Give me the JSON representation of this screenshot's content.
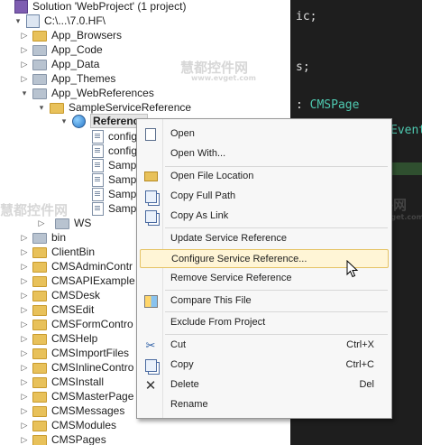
{
  "tree": {
    "items": [
      {
        "label": "Solution 'WebProject' (1 project)",
        "icon": "solution-icon",
        "indent": 0,
        "arrow": ""
      },
      {
        "label": "C:\\...\\7.0.HF\\",
        "icon": "project-icon",
        "indent": 1,
        "arrow": "▾"
      },
      {
        "label": "App_Browsers",
        "icon": "folder-icon",
        "indent": 2,
        "arrow": "▷"
      },
      {
        "label": "App_Code",
        "icon": "special-folder-icon",
        "indent": 2,
        "arrow": "▷"
      },
      {
        "label": "App_Data",
        "icon": "special-folder-icon",
        "indent": 2,
        "arrow": "▷"
      },
      {
        "label": "App_Themes",
        "icon": "special-folder-icon",
        "indent": 2,
        "arrow": "▷"
      },
      {
        "label": "App_WebReferences",
        "icon": "special-folder-icon",
        "indent": 2,
        "arrow": "▾"
      },
      {
        "label": "SampleServiceReference",
        "icon": "folder-icon",
        "indent": 3,
        "arrow": "▾"
      },
      {
        "label": "Reference",
        "icon": "globe-icon",
        "indent": 4,
        "arrow": "▾",
        "selected": true
      },
      {
        "label": "config",
        "icon": "file-icon",
        "indent": 5,
        "arrow": ""
      },
      {
        "label": "config",
        "icon": "file-icon",
        "indent": 5,
        "arrow": ""
      },
      {
        "label": "Samp",
        "icon": "file-icon",
        "indent": 5,
        "arrow": ""
      },
      {
        "label": "Samp",
        "icon": "file-icon",
        "indent": 5,
        "arrow": ""
      },
      {
        "label": "Samp",
        "icon": "file-icon",
        "indent": 5,
        "arrow": ""
      },
      {
        "label": "Samp",
        "icon": "file-icon",
        "indent": 5,
        "arrow": ""
      },
      {
        "label": "WS",
        "icon": "folder-icon",
        "indent": 4,
        "arrow": "▷"
      },
      {
        "label": "bin",
        "icon": "folder-icon",
        "indent": 2,
        "arrow": "▷"
      },
      {
        "label": "ClientBin",
        "icon": "folder-icon",
        "indent": 2,
        "arrow": "▷"
      },
      {
        "label": "CMSAdminContr",
        "icon": "folder-icon",
        "indent": 2,
        "arrow": "▷"
      },
      {
        "label": "CMSAPIExample",
        "icon": "folder-icon",
        "indent": 2,
        "arrow": "▷"
      },
      {
        "label": "CMSDesk",
        "icon": "folder-icon",
        "indent": 2,
        "arrow": "▷"
      },
      {
        "label": "CMSEdit",
        "icon": "folder-icon",
        "indent": 2,
        "arrow": "▷"
      },
      {
        "label": "CMSFormContro",
        "icon": "folder-icon",
        "indent": 2,
        "arrow": "▷"
      },
      {
        "label": "CMSHelp",
        "icon": "folder-icon",
        "indent": 2,
        "arrow": "▷"
      },
      {
        "label": "CMSImportFiles",
        "icon": "folder-icon",
        "indent": 2,
        "arrow": "▷"
      },
      {
        "label": "CMSInlineContro",
        "icon": "folder-icon",
        "indent": 2,
        "arrow": "▷"
      },
      {
        "label": "CMSInstall",
        "icon": "folder-icon",
        "indent": 2,
        "arrow": "▷"
      },
      {
        "label": "CMSMasterPage",
        "icon": "folder-icon",
        "indent": 2,
        "arrow": "▷"
      },
      {
        "label": "CMSMessages",
        "icon": "folder-icon",
        "indent": 2,
        "arrow": "▷"
      },
      {
        "label": "CMSModules",
        "icon": "folder-icon",
        "indent": 2,
        "arrow": "▷"
      },
      {
        "label": "CMSPages",
        "icon": "folder-icon",
        "indent": 2,
        "arrow": "▷"
      }
    ]
  },
  "editor": {
    "lines": [
      "ic;",
      "s;",
      ": CMSPage",
      "Event"
    ],
    "type_token": "CMSPage"
  },
  "watermarks": [
    "慧都控件网",
    "www.evget.com",
    "慧都控件网",
    "www.evget.com",
    "慧都控件网",
    "www.evget.com"
  ],
  "context_menu": {
    "items": [
      {
        "label": "Open",
        "icon": "document-icon",
        "shortcut": ""
      },
      {
        "label": "Open With...",
        "icon": "",
        "shortcut": ""
      },
      {
        "label": "Open File Location",
        "icon": "folder-open-icon",
        "shortcut": ""
      },
      {
        "label": "Copy Full Path",
        "icon": "copy-path-icon",
        "shortcut": ""
      },
      {
        "label": "Copy As Link",
        "icon": "copy-link-icon",
        "shortcut": ""
      },
      {
        "label": "Update Service Reference",
        "icon": "",
        "shortcut": ""
      },
      {
        "label": "Configure Service Reference...",
        "icon": "",
        "shortcut": "",
        "highlighted": true
      },
      {
        "label": "Remove Service Reference",
        "icon": "",
        "shortcut": ""
      },
      {
        "label": "Compare This File",
        "icon": "compare-icon",
        "shortcut": ""
      },
      {
        "label": "Exclude From Project",
        "icon": "",
        "shortcut": ""
      },
      {
        "label": "Cut",
        "icon": "cut-icon",
        "shortcut": "Ctrl+X"
      },
      {
        "label": "Copy",
        "icon": "copy-icon",
        "shortcut": "Ctrl+C"
      },
      {
        "label": "Delete",
        "icon": "delete-icon",
        "shortcut": "Del"
      },
      {
        "label": "Rename",
        "icon": "",
        "shortcut": ""
      }
    ]
  },
  "colors": {
    "menu_highlight": "#fff5d6",
    "editor_bg": "#1e1e1e",
    "type_color": "#4ec9b0"
  }
}
